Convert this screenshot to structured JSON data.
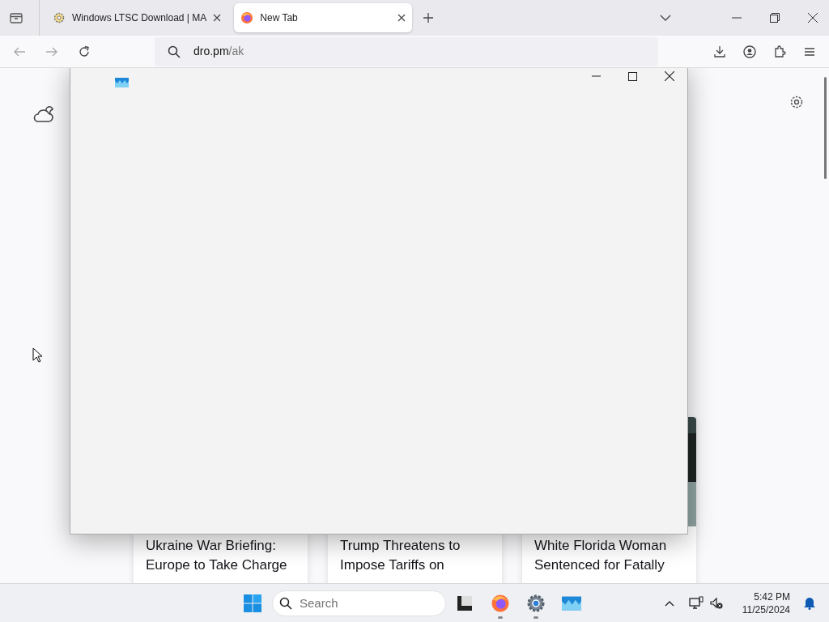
{
  "browser": {
    "tabs": [
      {
        "title": "Windows LTSC Download | MA",
        "kind": "gear",
        "selected": false
      },
      {
        "title": "New Tab",
        "kind": "firefox",
        "selected": true
      }
    ],
    "address": {
      "host": "dro.pm",
      "path": "/ak"
    }
  },
  "news_cards": [
    {
      "title": "Ukraine War Briefing: Europe to Take Charge"
    },
    {
      "title": "Trump Threatens to Impose Tariffs on"
    },
    {
      "title": "White Florida Woman Sentenced for Fatally"
    }
  ],
  "taskbar": {
    "search_placeholder": "Search",
    "apps": [
      {
        "kind": "files",
        "running": false
      },
      {
        "kind": "firefox",
        "running": true
      },
      {
        "kind": "settings",
        "running": true
      },
      {
        "kind": "app",
        "running": false
      }
    ],
    "time": "5:42 PM",
    "date": "11/25/2024"
  }
}
